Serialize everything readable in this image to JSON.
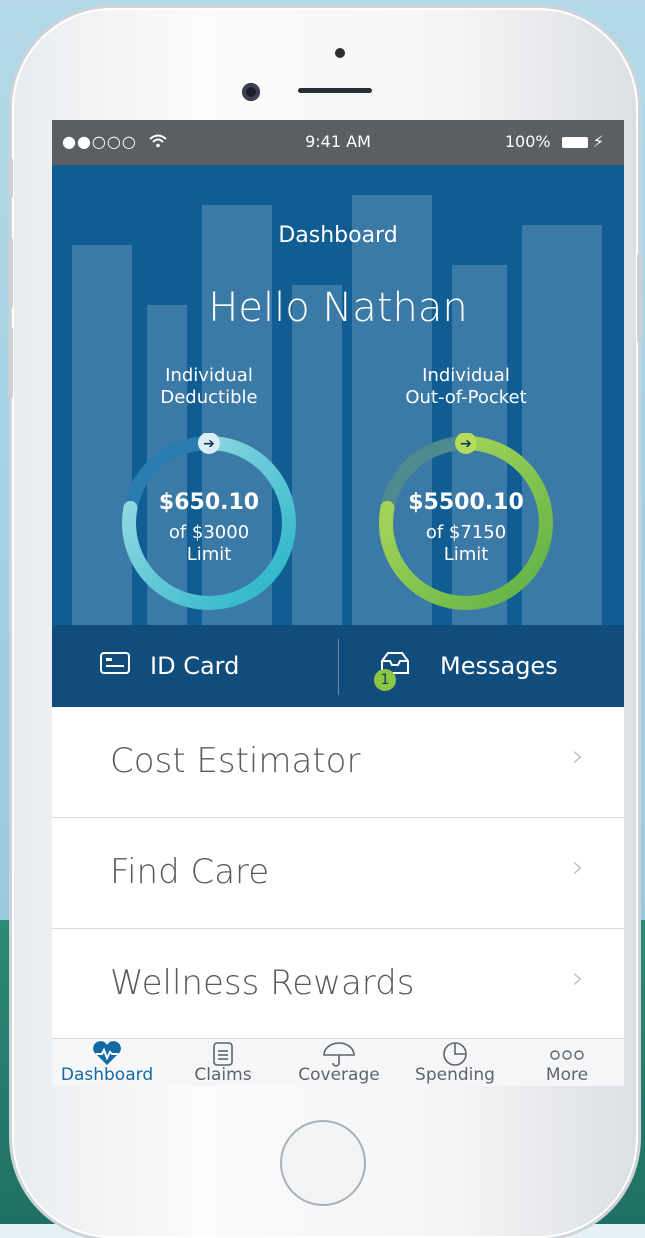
{
  "status_bar": {
    "signal": "●●○○○",
    "time": "9:41 AM",
    "battery": "100%"
  },
  "hero": {
    "title": "Dashboard",
    "greeting": "Hello Nathan"
  },
  "gauges": [
    {
      "label_line1": "Individual",
      "label_line2": "Deductible",
      "amount": "$650.10",
      "of_line1": "of $3000",
      "of_line2": "Limit",
      "progress": 0.217,
      "colors": {
        "start": "#23b3c7",
        "end": "#a9dfe8",
        "track": "#2a7bb0"
      }
    },
    {
      "label_line1": "Individual",
      "label_line2": "Out-of-Pocket",
      "amount": "$5500.10",
      "of_line1": "of $7150",
      "of_line2": "Limit",
      "progress": 0.769,
      "colors": {
        "start": "#5bb046",
        "end": "#b6dc5c",
        "track": "#2a7bb0"
      }
    }
  ],
  "actions": {
    "id_card": "ID Card",
    "messages": "Messages",
    "messages_badge": "1"
  },
  "list": [
    {
      "label": "Cost Estimator"
    },
    {
      "label": "Find Care"
    },
    {
      "label": "Wellness Rewards"
    }
  ],
  "tabs": [
    {
      "label": "Dashboard",
      "icon": "heart-pulse-icon",
      "active": true
    },
    {
      "label": "Claims",
      "icon": "document-icon",
      "active": false
    },
    {
      "label": "Coverage",
      "icon": "umbrella-icon",
      "active": false
    },
    {
      "label": "Spending",
      "icon": "pie-chart-icon",
      "active": false
    },
    {
      "label": "More",
      "icon": "more-icon",
      "active": false
    }
  ],
  "colors": {
    "brand_blue": "#0f5d92",
    "action_bar": "#114d7c",
    "tab_active": "#1369a6",
    "badge_green": "#8dc642"
  }
}
